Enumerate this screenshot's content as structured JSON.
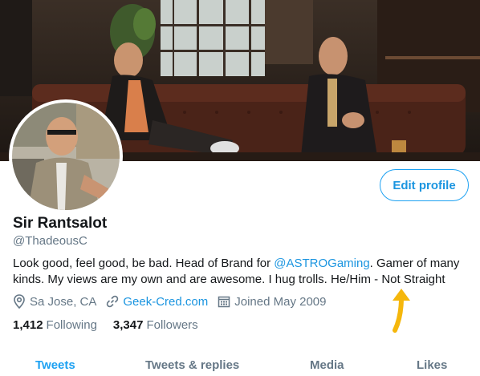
{
  "profile": {
    "name": "Sir Rantsalot",
    "handle": "@ThadeousC",
    "bio_part1": "Look good, feel good, be bad. Head of Brand for ",
    "bio_mention": "@ASTROGaming",
    "bio_part2": ". Gamer of many kinds. My views are my own and are awesome. I hug trolls. He/Him - Not Straight",
    "location": "Sa Jose, CA",
    "website": "Geek-Cred.com",
    "joined": "Joined May 2009",
    "following_count": "1,412",
    "following_label": "Following",
    "followers_count": "3,347",
    "followers_label": "Followers"
  },
  "actions": {
    "edit_profile_label": "Edit profile"
  },
  "tabs": [
    {
      "label": "Tweets",
      "active": true
    },
    {
      "label": "Tweets & replies",
      "active": false
    },
    {
      "label": "Media",
      "active": false
    },
    {
      "label": "Likes",
      "active": false
    }
  ],
  "icons": {
    "location": "location-pin-icon",
    "website": "link-icon",
    "joined": "calendar-icon",
    "annotation": "arrow-annotation-icon"
  },
  "colors": {
    "accent": "#1da1f2",
    "link": "#1b95e0",
    "secondary_text": "#657786",
    "annotation_arrow": "#f5b70c"
  }
}
